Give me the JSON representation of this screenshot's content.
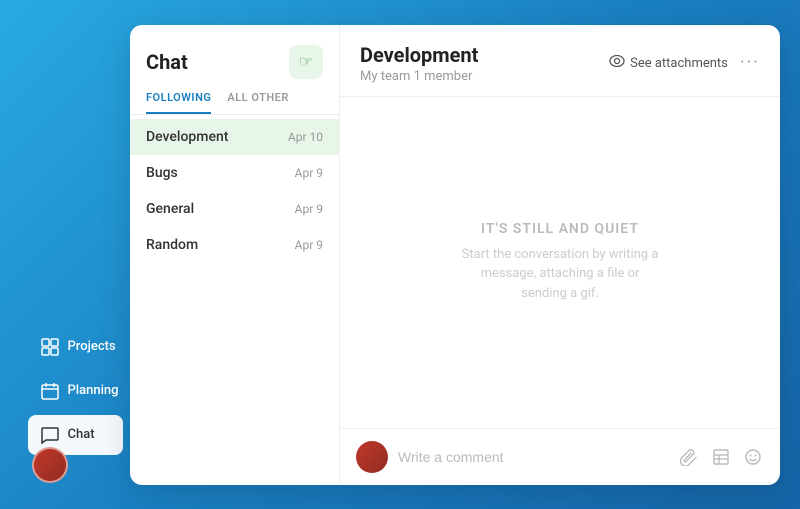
{
  "sidebar": {
    "items": [
      {
        "id": "projects",
        "label": "Projects",
        "icon": "📋",
        "active": false
      },
      {
        "id": "planning",
        "label": "Planning",
        "icon": "📅",
        "active": false
      },
      {
        "id": "chat",
        "label": "Chat",
        "icon": "💬",
        "active": true
      }
    ]
  },
  "chat_list": {
    "title": "Chat",
    "new_chat_button_label": "✋",
    "tabs": [
      {
        "id": "following",
        "label": "FOLLOWING",
        "active": true
      },
      {
        "id": "all_other",
        "label": "ALL OTHER",
        "active": false
      }
    ],
    "items": [
      {
        "id": "development",
        "name": "Development",
        "date": "Apr 10",
        "active": true
      },
      {
        "id": "bugs",
        "name": "Bugs",
        "date": "Apr 9",
        "active": false
      },
      {
        "id": "general",
        "name": "General",
        "date": "Apr 9",
        "active": false
      },
      {
        "id": "random",
        "name": "Random",
        "date": "Apr 9",
        "active": false
      }
    ]
  },
  "chat_content": {
    "title": "Development",
    "subtitle": "My team  1 member",
    "see_attachments_label": "See attachments",
    "empty_title": "IT'S STILL AND QUIET",
    "empty_subtitle": "Start the conversation by writing a message, attaching a file or sending a gif.",
    "input_placeholder": "Write a comment"
  },
  "icons": {
    "eye": "👁",
    "paperclip": "📎",
    "table": "⊞",
    "emoji": "🙂"
  }
}
